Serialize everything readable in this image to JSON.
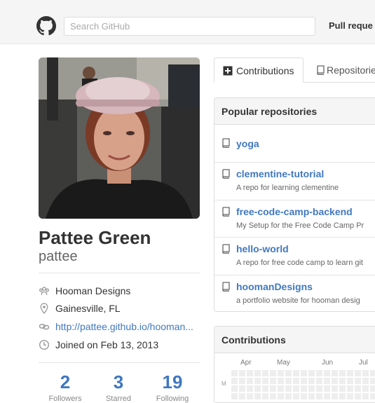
{
  "header": {
    "search_placeholder": "Search GitHub",
    "nav_link": "Pull reque"
  },
  "profile": {
    "full_name": "Pattee Green",
    "username": "pattee",
    "organization": "Hooman Designs",
    "location": "Gainesville, FL",
    "website": "http://pattee.github.io/hooman...",
    "joined": "Joined on Feb 13, 2013",
    "stats": [
      {
        "value": "2",
        "label": "Followers"
      },
      {
        "value": "3",
        "label": "Starred"
      },
      {
        "value": "19",
        "label": "Following"
      }
    ]
  },
  "tabs": [
    {
      "label": "Contributions",
      "icon": "plus-square-icon",
      "selected": true
    },
    {
      "label": "Repositorie",
      "icon": "repo-icon",
      "selected": false
    }
  ],
  "popular_repos": {
    "title": "Popular repositories",
    "items": [
      {
        "name": "yoga",
        "description": ""
      },
      {
        "name": "clementine-tutorial",
        "description": "A repo for learning clementine"
      },
      {
        "name": "free-code-camp-backend",
        "description": "My Setup for the Free Code Camp Pr"
      },
      {
        "name": "hello-world",
        "description": "A repo for free code camp to learn git"
      },
      {
        "name": "hoomanDesigns",
        "description": "a portfolio website for hooman desig"
      }
    ]
  },
  "contributions": {
    "title": "Contributions",
    "months": [
      "Apr",
      "May",
      "Jun",
      "Jul"
    ],
    "day_label": "M"
  },
  "colors": {
    "link": "#4078c0",
    "header_bg": "#f5f5f5",
    "border": "#dddddd",
    "empty_cell": "#eeeeee"
  }
}
